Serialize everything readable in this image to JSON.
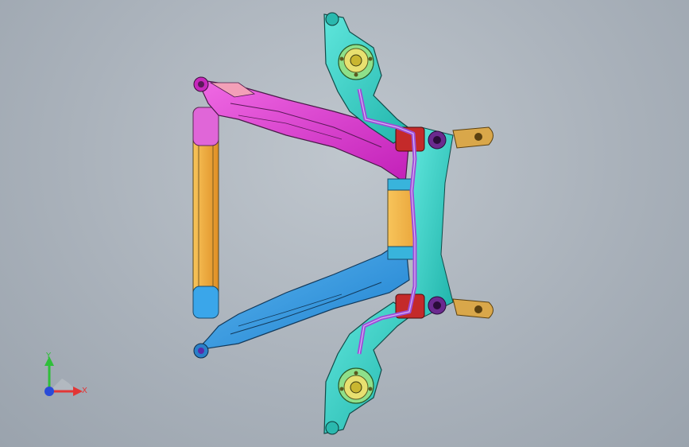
{
  "viewport": {
    "background_top": "#bfc6cd",
    "background_bottom": "#9aa3ad"
  },
  "model": {
    "part_colors": {
      "magenta": "#e23ad6",
      "blue": "#2f9be6",
      "orange": "#f2a53a",
      "cyan": "#34d3c8",
      "yellow": "#e8e070",
      "red": "#c42a2a",
      "purple": "#9d4ed8",
      "gold": "#d9a74a"
    }
  },
  "triad": {
    "y_label": "Y",
    "x_label": "X",
    "y_color": "#2fbf3a",
    "x_color": "#e23636",
    "z_color": "#2a4bd8"
  }
}
